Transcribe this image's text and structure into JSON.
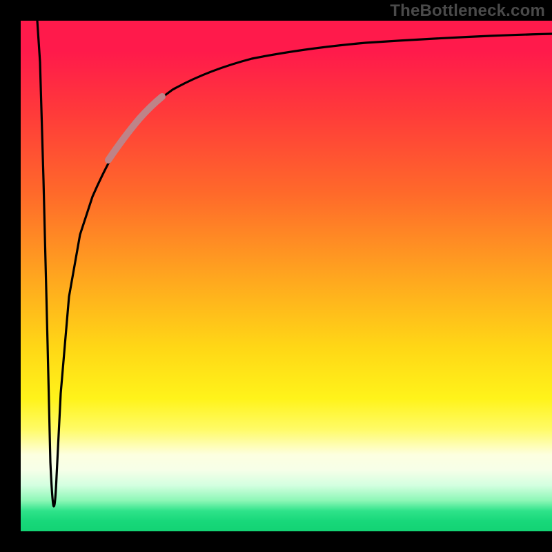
{
  "watermark": "TheBottleneck.com",
  "colors": {
    "frame": "#000000",
    "curve_main": "#000000",
    "curve_highlight": "#be8388",
    "watermark": "#4a4a4a"
  },
  "chart_data": {
    "type": "line",
    "title": "",
    "xlabel": "",
    "ylabel": "",
    "xlim": [
      0,
      100
    ],
    "ylim": [
      0,
      100
    ],
    "grid": false,
    "legend": false,
    "notes": "No axis ticks or labels are visible; values are normalized 0–100 estimates from pixel positions. Curve starts top-left, plunges to a sharp minimum near x≈6 y≈5, then rises steeply and asymptotes near y≈96 at the right edge. A short brown/pink highlight overlays the curve roughly over x∈[17,25].",
    "series": [
      {
        "name": "bottleneck-curve",
        "x": [
          3.1,
          4.0,
          5.0,
          5.6,
          6.2,
          6.8,
          8.0,
          10.0,
          12.0,
          14.0,
          17.0,
          20.0,
          24.0,
          30.0,
          38.0,
          48.0,
          60.0,
          75.0,
          90.0,
          100.0
        ],
        "y": [
          100.0,
          70.0,
          30.0,
          10.0,
          5.0,
          12.0,
          30.0,
          48.0,
          58.0,
          65.0,
          72.0,
          77.0,
          82.0,
          86.5,
          90.0,
          92.3,
          93.8,
          94.9,
          95.6,
          96.0
        ]
      }
    ],
    "highlight_range_x": [
      17,
      25
    ]
  }
}
